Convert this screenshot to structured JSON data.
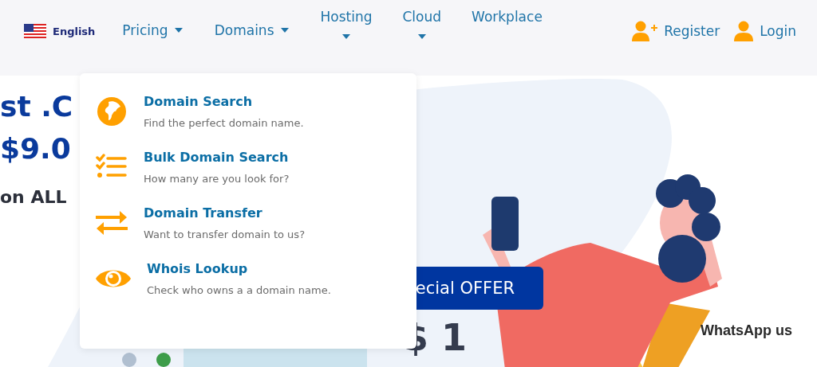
{
  "nav": {
    "language": {
      "label": "English"
    },
    "items": [
      {
        "label": "Pricing",
        "kind": "inline"
      },
      {
        "label": "Domains",
        "kind": "inline"
      },
      {
        "label": "Hosting",
        "kind": "stacked"
      },
      {
        "label": "Cloud",
        "kind": "stacked"
      },
      {
        "label": "Workplace",
        "kind": "plain"
      }
    ],
    "account": [
      {
        "label": "Register",
        "kind": "register"
      },
      {
        "label": "Login",
        "kind": "login"
      }
    ]
  },
  "dropdown": {
    "items": [
      {
        "title": "Domain Search",
        "description": "Find the perfect domain name.",
        "kind": "globe"
      },
      {
        "title": "Bulk Domain Search",
        "description": "How many are you look for?",
        "kind": "checklist"
      },
      {
        "title": "Domain Transfer",
        "description": "Want to transfer domain to us?",
        "kind": "transfer"
      },
      {
        "title": "Whois Lookup",
        "description": "Check who owns a a domain name.",
        "kind": "eye"
      }
    ]
  },
  "hero": {
    "lines": [
      "st .C",
      "$9.0",
      "on ALL"
    ],
    "offer": "ecial OFFER",
    "price": "$ 1"
  },
  "whatsapp": {
    "label": "WhatsApp us"
  }
}
